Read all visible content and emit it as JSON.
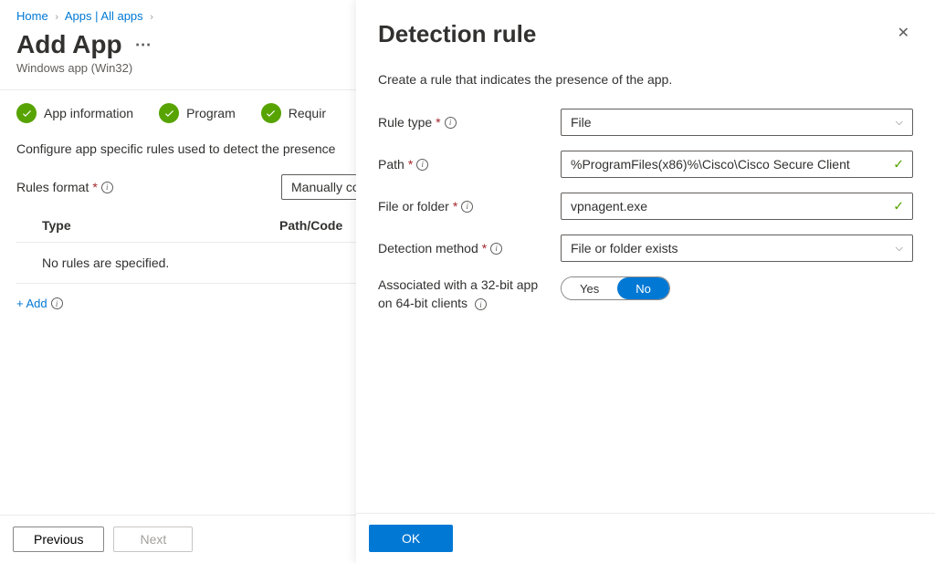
{
  "breadcrumb": {
    "home": "Home",
    "apps": "Apps | All apps"
  },
  "page": {
    "title": "Add App",
    "subtitle": "Windows app (Win32)"
  },
  "steps": {
    "appInfo": "App information",
    "program": "Program",
    "require": "Requir"
  },
  "configText": "Configure app specific rules used to detect the presence ",
  "rulesFormat": {
    "label": "Rules format",
    "value": "Manually co"
  },
  "table": {
    "typeHeader": "Type",
    "pathHeader": "Path/Code",
    "empty": "No rules are specified."
  },
  "addLink": "+ Add",
  "footer": {
    "previous": "Previous",
    "next": "Next"
  },
  "panel": {
    "title": "Detection rule",
    "desc": "Create a rule that indicates the presence of the app.",
    "ruleType": {
      "label": "Rule type",
      "value": "File"
    },
    "path": {
      "label": "Path",
      "value": "%ProgramFiles(x86)%\\Cisco\\Cisco Secure Client"
    },
    "file": {
      "label": "File or folder",
      "value": "vpnagent.exe"
    },
    "detection": {
      "label": "Detection method",
      "value": "File or folder exists"
    },
    "assoc": {
      "label1": "Associated with a 32-bit app",
      "label2": "on 64-bit clients",
      "yes": "Yes",
      "no": "No"
    },
    "ok": "OK"
  }
}
